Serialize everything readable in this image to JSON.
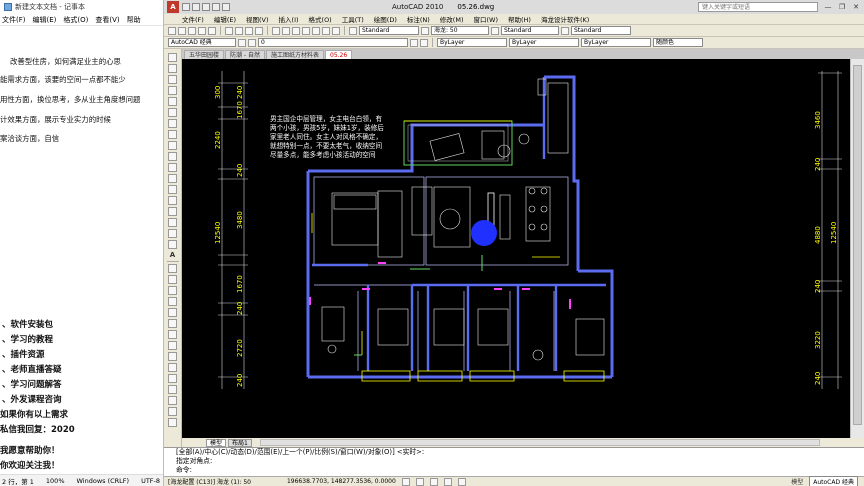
{
  "notepad": {
    "title": "新建文本文档 - 记事本",
    "menu": [
      "文件(F)",
      "编辑(E)",
      "格式(O)",
      "查看(V)",
      "帮助"
    ],
    "lines": [
      "改善型住房，如何满足业主的心思",
      "能需求方面，该要的空间一点都不能少",
      "用性方面，换位思考，多从业主角度想问题",
      "计效果方面，展示专业实力的时候",
      "案洽谈方面，自信"
    ],
    "bold_lines": [
      "、软件安装包",
      "、学习的教程",
      "、插件资源",
      "、老师直播答疑",
      "、学习问题解答",
      "、外发课程咨询",
      "如果你有以上需求",
      "私信我回复：2020",
      "我愿意帮助你！",
      "你欢迎关注我！"
    ],
    "status": {
      "position": "2 行，第 1",
      "zoom": "100%",
      "eol": "Windows (CRLF)",
      "encoding": "UTF-8"
    }
  },
  "autocad": {
    "app_title": "AutoCAD 2010",
    "file_name": "05.26.dwg",
    "search_placeholder": "键入关键字或短语",
    "menu": [
      "文件(F)",
      "编辑(E)",
      "视图(V)",
      "插入(I)",
      "格式(O)",
      "工具(T)",
      "绘图(D)",
      "标注(N)",
      "修改(M)",
      "窗口(W)",
      "帮助(H)",
      "海龙设计软件(K)"
    ],
    "toolbar": {
      "textstyle": "Standard",
      "dimstyle": "海龙: 50",
      "tablestyle": "Standard",
      "mleaderstyle": "Standard",
      "workspace": "AutoCAD 经典",
      "layer": "0",
      "color": "ByLayer",
      "linetype": "ByLayer",
      "lineweight": "ByLayer",
      "plotstyle": "随颜色"
    },
    "doc_tabs": [
      "五华田园楼",
      "防潮 - 自然",
      "施工图纸方材料表",
      "05.26"
    ],
    "layout_tabs": [
      "模型",
      "布局1"
    ],
    "command_lines": [
      "[全部(A)/中心(C)/动态(D)/范围(E)/上一个(P)/比例(S)/窗口(W)/对象(O)] <实时>:",
      "指定对角点:",
      "命令:"
    ],
    "status": {
      "left": "[海龙配置 (C13)] 海龙 (1): 50",
      "coords": "196638.7703, 148277.3536, 0.0000",
      "space": "模型",
      "workspace": "AutoCAD 经典"
    }
  },
  "drawing": {
    "note": [
      "男主国企中层管理，女主电台白领，有",
      "两个小孩，男孩5岁，妹妹1岁，装修后",
      "家里老人同住。女主人对风格不确定，",
      "就想特别一点，不要太老气，收纳空间",
      "尽量多点，能多考虑小孩活动的空间"
    ],
    "left_dims": [
      "240",
      "1670",
      "240",
      "3480",
      "12540",
      "1670",
      "240",
      "2720",
      "240"
    ],
    "left_top_dims": [
      "300",
      "2240"
    ],
    "right_dims": [
      "3460",
      "240",
      "4880",
      "240",
      "12540",
      "3220",
      "240"
    ],
    "colors": {
      "wall": "#5b6cf0",
      "frame": "#ffffff",
      "accent": "#ffff00",
      "cursor": "#2030ff",
      "dim": "#ffff00",
      "pink": "#ff40ff"
    }
  }
}
